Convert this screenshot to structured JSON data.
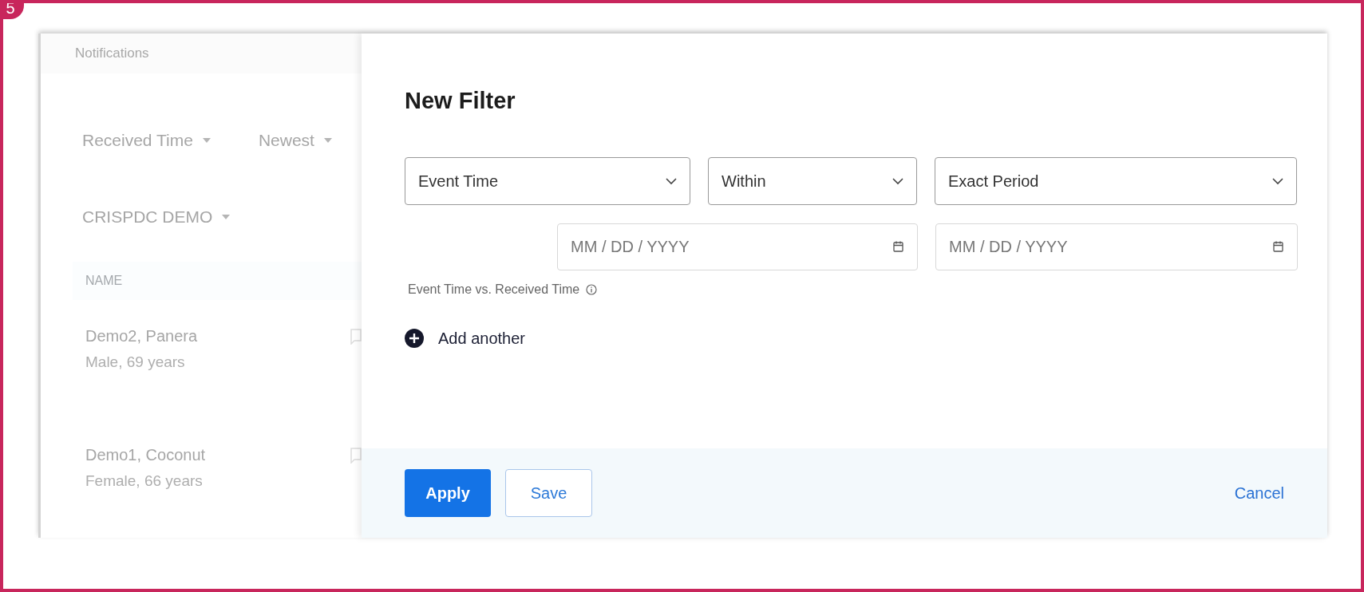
{
  "step_badge": "5",
  "background_panel": {
    "title": "Notifications",
    "sort_field": "Received Time",
    "sort_order": "Newest",
    "group": "CRISPDC DEMO",
    "column_header": "NAME",
    "rows": [
      {
        "name": "Demo2, Panera",
        "detail": "Male, 69 years"
      },
      {
        "name": "Demo1, Coconut",
        "detail": "Female, 66 years"
      }
    ]
  },
  "dialog": {
    "title": "New Filter",
    "selects": [
      {
        "value": "Event Time"
      },
      {
        "value": "Within"
      },
      {
        "value": "Exact Period"
      }
    ],
    "date_fields": [
      {
        "placeholder": "MM / DD / YYYY"
      },
      {
        "placeholder": "MM / DD / YYYY"
      }
    ],
    "hint": "Event Time vs. Received Time",
    "add_label": "Add another",
    "buttons": [
      {
        "label": "Apply",
        "kind": "primary"
      },
      {
        "label": "Save",
        "kind": "secondary"
      },
      {
        "label": "Cancel",
        "kind": "link"
      }
    ]
  }
}
